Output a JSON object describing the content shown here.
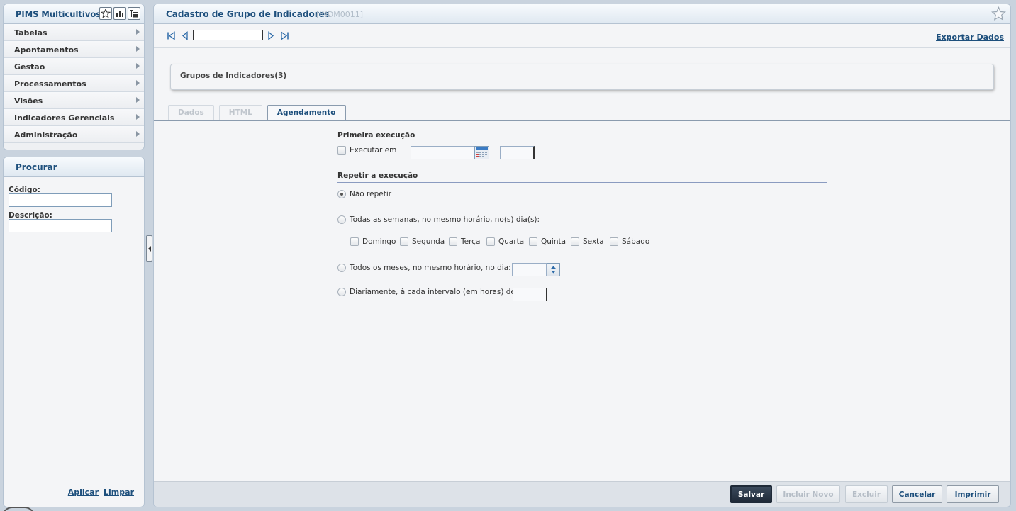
{
  "app": {
    "title": "PIMS Multicultivos"
  },
  "menu": {
    "items": [
      {
        "label": "Tabelas"
      },
      {
        "label": "Apontamentos"
      },
      {
        "label": "Gestão"
      },
      {
        "label": "Processamentos"
      },
      {
        "label": "Visões"
      },
      {
        "label": "Indicadores Gerenciais"
      },
      {
        "label": "Administração"
      }
    ]
  },
  "search": {
    "title": "Procurar",
    "code_label": "Código:",
    "code_value": "",
    "description_label": "Descrição:",
    "description_value": "",
    "apply_label": "Aplicar",
    "clear_label": "Limpar"
  },
  "page": {
    "title": "Cadastro de Grupo de Indicadores",
    "code": "[INDM0011]",
    "record_value": "'",
    "export_label": "Exportar Dados",
    "group_title": "Grupos de Indicadores(3)"
  },
  "tabs": [
    {
      "label": "Dados",
      "active": false
    },
    {
      "label": "HTML",
      "active": false
    },
    {
      "label": "Agendamento",
      "active": true
    }
  ],
  "schedule": {
    "first_run_title": "Primeira execução",
    "execute_at_label": "Executar em",
    "execute_at_checked": false,
    "date_value": "",
    "time_value": "",
    "repeat_title": "Repetir a execução",
    "no_repeat_label": "Não repetir",
    "weekly_label": "Todas as semanas, no mesmo horário, no(s) dia(s):",
    "days": [
      "Domingo",
      "Segunda",
      "Terça",
      "Quarta",
      "Quinta",
      "Sexta",
      "Sábado"
    ],
    "monthly_label": "Todos os meses, no mesmo horário, no dia:",
    "monthly_day_value": "",
    "daily_label": "Diariamente, à cada intervalo (em horas) de:",
    "daily_interval_value": "",
    "selected_option": "no_repeat"
  },
  "actions": {
    "save": "Salvar",
    "new": "Incluir Novo",
    "delete": "Excluir",
    "cancel": "Cancelar",
    "print": "Imprimir"
  },
  "colors": {
    "accent": "#1d4f7c",
    "background": "#c9d3de",
    "panel": "#f4f5f7"
  }
}
